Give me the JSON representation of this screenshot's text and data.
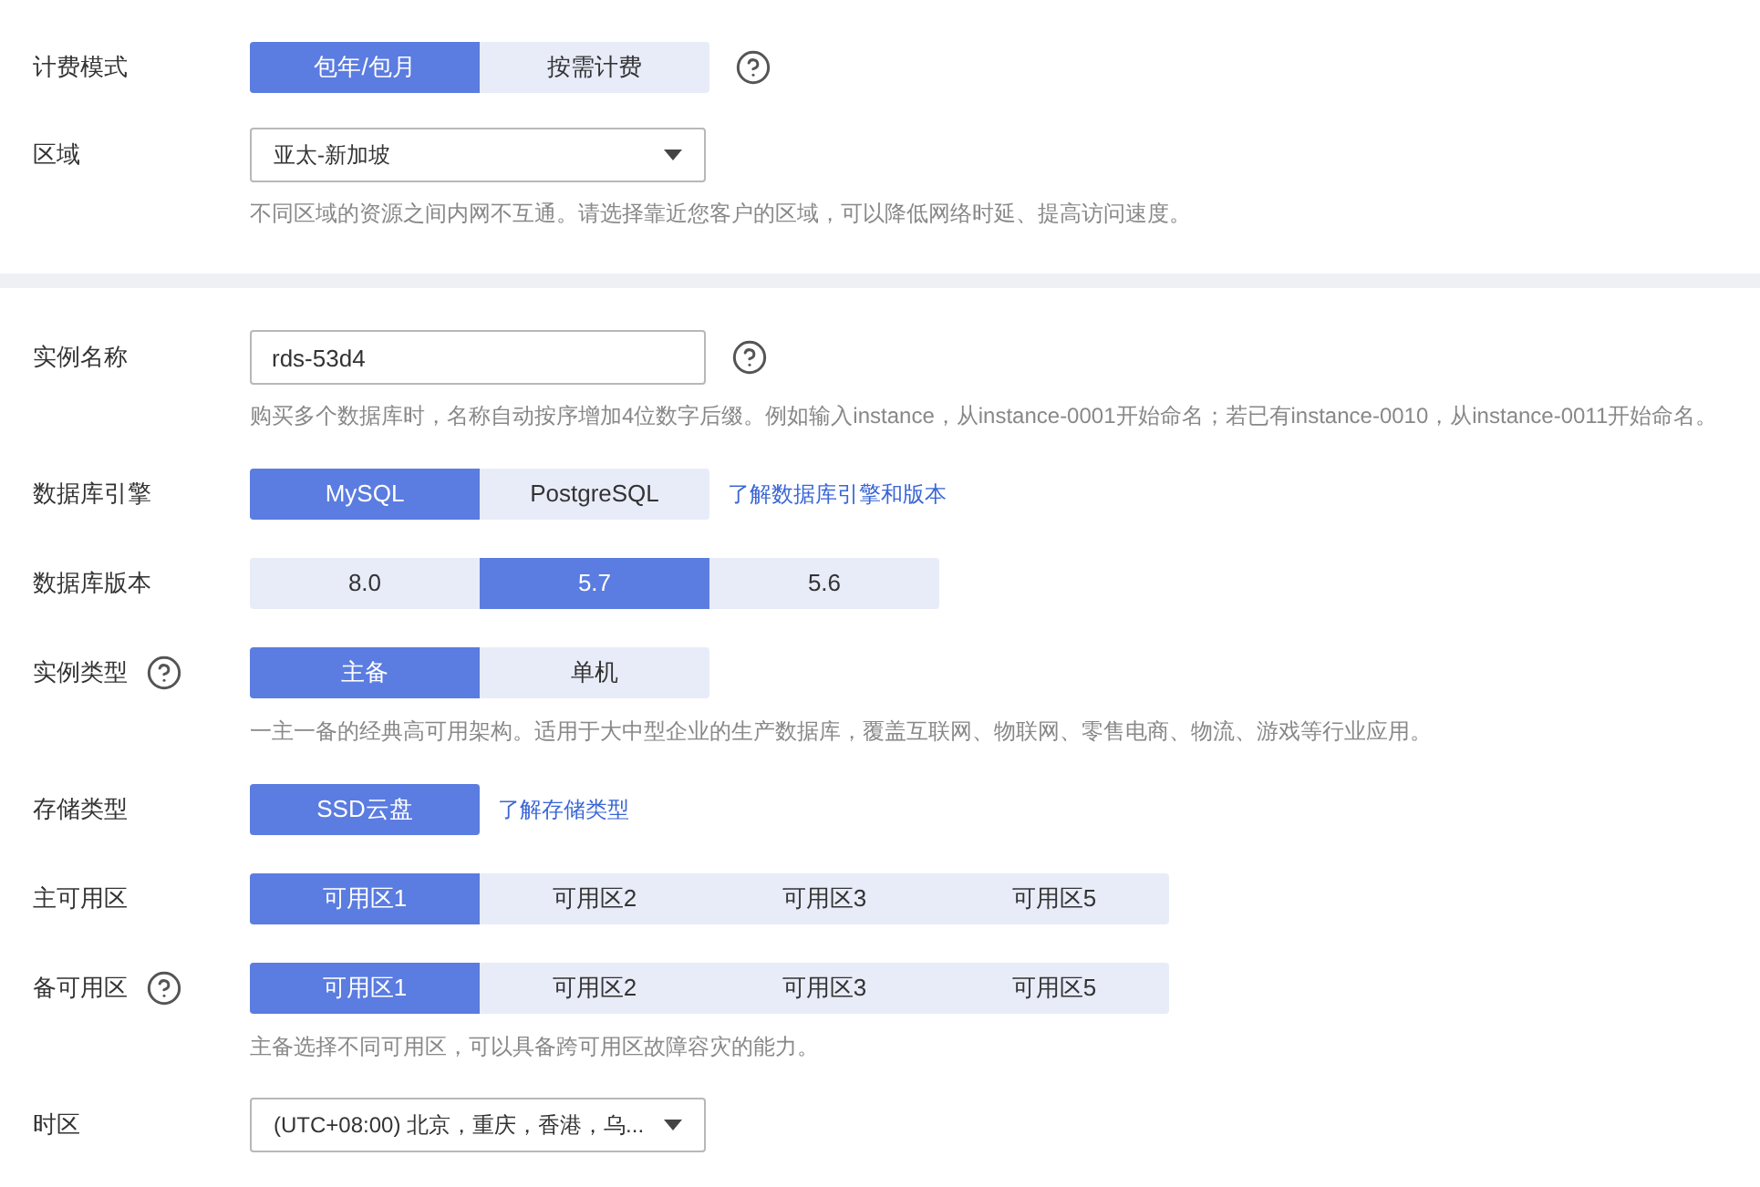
{
  "sections": [
    {
      "fields": [
        {
          "kind": "segmented",
          "label": "计费模式",
          "help_after_control": true,
          "options": [
            {
              "label": "包年/包月",
              "selected": true
            },
            {
              "label": "按需计费",
              "selected": false
            }
          ]
        },
        {
          "kind": "select",
          "label": "区域",
          "value": "亚太-新加坡",
          "hint": "不同区域的资源之间内网不互通。请选择靠近您客户的区域，可以降低网络时延、提高访问速度。"
        }
      ]
    },
    {
      "fields": [
        {
          "kind": "input",
          "label": "实例名称",
          "value": "rds-53d4",
          "help_after_control": true,
          "hint": "购买多个数据库时，名称自动按序增加4位数字后缀。例如输入instance，从instance-0001开始命名；若已有instance-0010，从instance-0011开始命名。"
        },
        {
          "kind": "segmented",
          "label": "数据库引擎",
          "options": [
            {
              "label": "MySQL",
              "selected": true
            },
            {
              "label": "PostgreSQL",
              "selected": false
            }
          ],
          "link": "了解数据库引擎和版本"
        },
        {
          "kind": "segmented",
          "label": "数据库版本",
          "options": [
            {
              "label": "8.0",
              "selected": false
            },
            {
              "label": "5.7",
              "selected": true
            },
            {
              "label": "5.6",
              "selected": false
            }
          ]
        },
        {
          "kind": "segmented",
          "label": "实例类型",
          "help_after_label": true,
          "options": [
            {
              "label": "主备",
              "selected": true
            },
            {
              "label": "单机",
              "selected": false
            }
          ],
          "hint": "一主一备的经典高可用架构。适用于大中型企业的生产数据库，覆盖互联网、物联网、零售电商、物流、游戏等行业应用。"
        },
        {
          "kind": "segmented",
          "label": "存储类型",
          "options": [
            {
              "label": "SSD云盘",
              "selected": true
            }
          ],
          "link": "了解存储类型"
        },
        {
          "kind": "segmented",
          "label": "主可用区",
          "options": [
            {
              "label": "可用区1",
              "selected": true
            },
            {
              "label": "可用区2",
              "selected": false
            },
            {
              "label": "可用区3",
              "selected": false
            },
            {
              "label": "可用区5",
              "selected": false
            }
          ]
        },
        {
          "kind": "segmented",
          "label": "备可用区",
          "help_after_label": true,
          "options": [
            {
              "label": "可用区1",
              "selected": true
            },
            {
              "label": "可用区2",
              "selected": false
            },
            {
              "label": "可用区3",
              "selected": false
            },
            {
              "label": "可用区5",
              "selected": false
            }
          ],
          "hint": "主备选择不同可用区，可以具备跨可用区故障容灾的能力。"
        },
        {
          "kind": "select",
          "label": "时区",
          "value": "(UTC+08:00) 北京，重庆，香港，乌..."
        }
      ]
    }
  ]
}
